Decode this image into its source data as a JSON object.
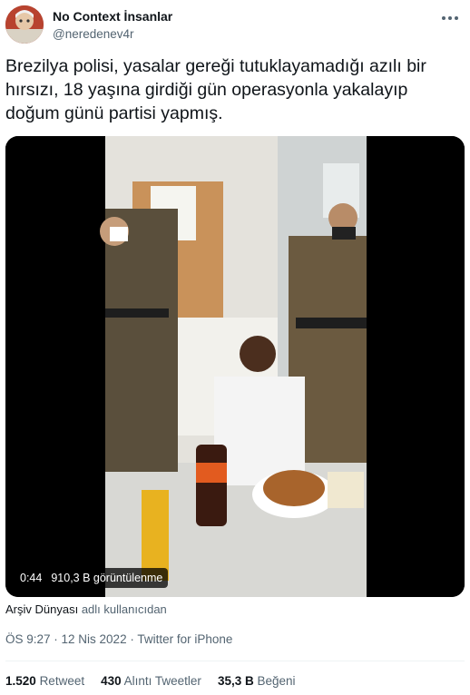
{
  "author": {
    "name": "No Context İnsanlar",
    "handle": "@neredenev4r"
  },
  "tweet": {
    "text": "Brezilya polisi, yasalar gereği tutuklayamadığı azılı bir hırsızı, 18 yaşına girdiği gün operasyonla yakalayıp doğum günü partisi yapmış."
  },
  "video": {
    "duration": "0:44",
    "views": "910,3 B görüntülenme"
  },
  "attribution": {
    "source": "Arşiv Dünyası",
    "suffix": "adlı kullanıcıdan"
  },
  "meta": {
    "timestamp": "ÖS 9:27 · 12 Nis 2022 · Twitter for iPhone"
  },
  "stats": {
    "retweets_count": "1.520",
    "retweets_label": "Retweet",
    "quotes_count": "430",
    "quotes_label": "Alıntı Tweetler",
    "likes_count": "35,3 B",
    "likes_label": "Beğeni"
  },
  "icons": [
    "more-options-icon"
  ]
}
